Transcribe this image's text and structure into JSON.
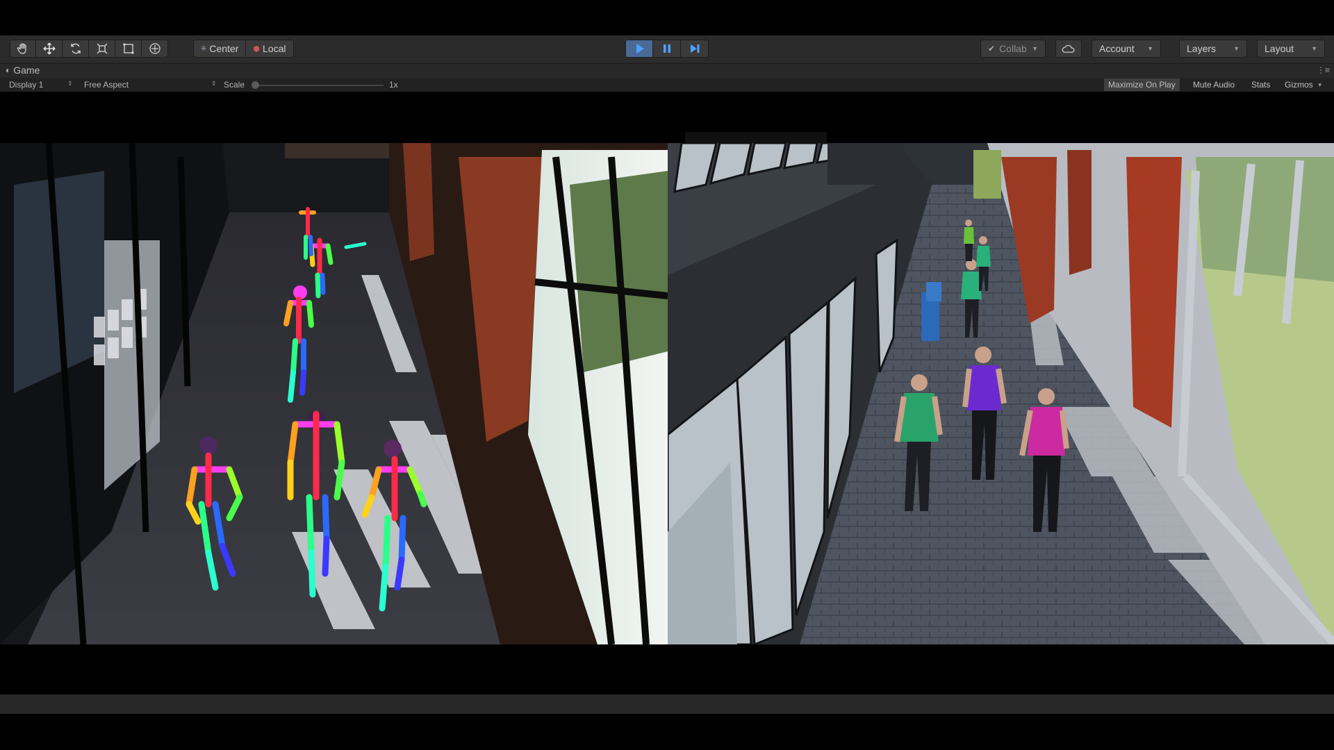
{
  "toolbar": {
    "transform_tools": [
      {
        "icon": "hand-icon",
        "name": "hand-tool"
      },
      {
        "icon": "move-icon",
        "name": "move-tool"
      },
      {
        "icon": "rotate-icon",
        "name": "rotate-tool"
      },
      {
        "icon": "scale-icon",
        "name": "scale-tool"
      },
      {
        "icon": "rect-tool-icon",
        "name": "rect-tool"
      },
      {
        "icon": "transform-tool-icon",
        "name": "transform-tool"
      }
    ],
    "pivot_label": "Center",
    "space_label": "Local",
    "play_active": true,
    "collab_label": "Collab",
    "account_label": "Account",
    "layers_label": "Layers",
    "layout_label": "Layout"
  },
  "game_view": {
    "tab_label": "Game",
    "display": "Display 1",
    "aspect": "Free Aspect",
    "scale_label": "Scale",
    "scale_value": "1x",
    "maximize_label": "Maximize On Play",
    "maximize_on": true,
    "mute_label": "Mute Audio",
    "stats_label": "Stats",
    "gizmos_label": "Gizmos"
  },
  "colors": {
    "toolbar_bg": "#2b2b2b",
    "play_active": "#4a6a95",
    "brick": "#8a3a22",
    "floor_real": "#3a3a42",
    "floor_sim": "#4e5560"
  },
  "scenes": {
    "left": {
      "pose_figures": 6
    },
    "right": {
      "avatars": 6
    }
  }
}
